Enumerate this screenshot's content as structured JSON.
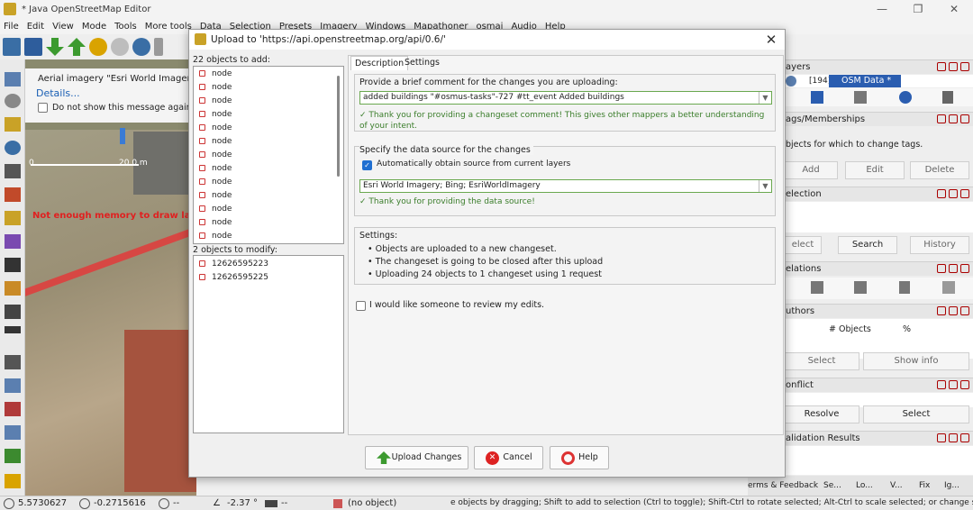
{
  "window": {
    "title": "* Java OpenStreetMap Editor"
  },
  "menu": [
    "File",
    "Edit",
    "View",
    "Mode",
    "Tools",
    "More tools",
    "Data",
    "Selection",
    "Presets",
    "Imagery",
    "Windows",
    "Mapathoner",
    "osmaj",
    "Audio",
    "Help"
  ],
  "map_notice": {
    "text": "Aerial imagery \"Esri World Imagery\" m",
    "details": "Details...",
    "checkbox": "Do not show this message again",
    "scale": "20.0 m",
    "scale_zero": "0",
    "memory_warning": "Not enough memory to draw lay"
  },
  "dialog": {
    "title": "Upload to 'https://api.openstreetmap.org/api/0.6/'",
    "add_header": "22 objects to add:",
    "add_items": [
      "node",
      "node",
      "node",
      "node",
      "node",
      "node",
      "node",
      "node",
      "node",
      "node",
      "node",
      "node",
      "node"
    ],
    "modify_header": "2 objects to modify:",
    "modify_items": [
      "12626595223",
      "12626595225"
    ],
    "tabs": [
      "Description",
      "Settings"
    ],
    "comment_label": "Provide a brief comment for the changes you are uploading:",
    "comment_value": "added buildings \"#osmus-tasks\"-727 #tt_event Added buildings",
    "comment_ok": "✓ Thank you for providing a changeset comment! This gives other mappers a better understanding of your intent.",
    "source_group": "Specify the data source for the changes",
    "source_auto": "Automatically obtain source from current layers",
    "source_value": "Esri World Imagery; Bing; EsriWorldImagery",
    "source_ok": "✓ Thank you for providing the data source!",
    "settings_label": "Settings:",
    "settings_items": [
      "Objects are uploaded to a new changeset.",
      "The changeset is going to be closed after this upload",
      "Uploading 24 objects to 1 changeset using 1 request"
    ],
    "review_label": "I would like someone to review my edits.",
    "buttons": {
      "upload": "Upload Changes",
      "cancel": "Cancel",
      "help": "Help"
    }
  },
  "right": {
    "layers_title": "ayers",
    "layer_count": "[194]",
    "layer_name": "OSM Data *",
    "tags_title": "ags/Memberships",
    "tags_msg": "bjects for which to change tags.",
    "tags_buttons": [
      "Add",
      "Edit",
      "Delete"
    ],
    "selection_title": "election",
    "selection_buttons": [
      "elect",
      "Search",
      "History"
    ],
    "relations_title": "elations",
    "authors_title": "uthors",
    "authors_cols": [
      "# Objects",
      "%"
    ],
    "authors_buttons": [
      "Select",
      "Show info"
    ],
    "conflict_title": "onflict",
    "conflict_buttons": [
      "Resolve",
      "Select"
    ],
    "validation_title": "alidation Results",
    "bottom_tabs": [
      "Se...",
      "Lo...",
      "V...",
      "Fix",
      "Ig...",
      "M..."
    ],
    "attribution": "erms & Feedback"
  },
  "status": {
    "lat": "5.5730627",
    "lon": "-0.2715616",
    "heading": "--",
    "angle": "-2.37 °",
    "dist": "--",
    "object": "(no object)",
    "hint": "e objects by dragging; Shift to add to selection (Ctrl to toggle); Shift-Ctrl to rotate selected; Alt-Ctrl to scale selected; or change selection"
  }
}
